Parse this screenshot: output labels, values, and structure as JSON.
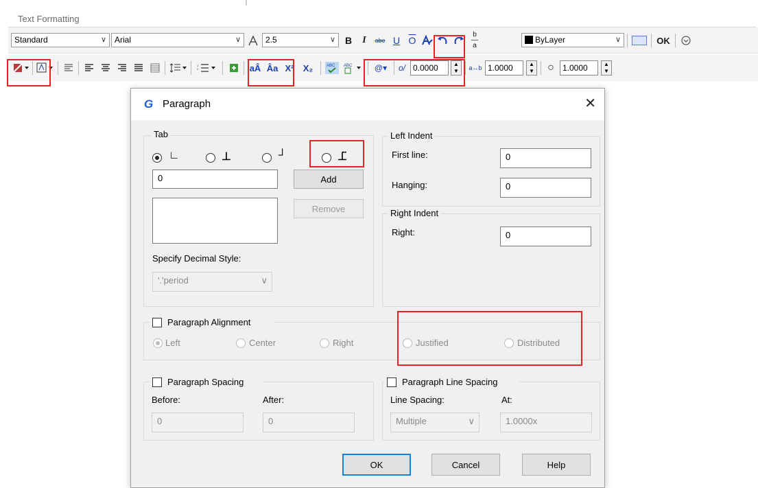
{
  "toolbar": {
    "title": "Text Formatting",
    "style_value": "Standard",
    "font_value": "Arial",
    "height_value": "2.5",
    "bold": "B",
    "italic": "I",
    "strike": "abe",
    "underline": "U",
    "overline": "O",
    "color_value": "ByLayer",
    "ok_label": "OK",
    "oblique_value": "0.0000",
    "tracking_value": "1.0000",
    "width_value": "1.0000",
    "superscript": "X²",
    "subscript": "X₂",
    "accent": "#e32424"
  },
  "dialog": {
    "title": "Paragraph",
    "tab_group": "Tab",
    "tab_value": "0",
    "add_button": "Add",
    "remove_button": "Remove",
    "decimal_label": "Specify Decimal Style:",
    "decimal_value": "'.'period",
    "left_indent": {
      "group": "Left Indent",
      "first_line_label": "First line:",
      "first_line_value": "0",
      "hanging_label": "Hanging:",
      "hanging_value": "0"
    },
    "right_indent": {
      "group": "Right Indent",
      "right_label": "Right:",
      "right_value": "0"
    },
    "alignment": {
      "label": "Paragraph Alignment",
      "options": [
        "Left",
        "Center",
        "Right",
        "Justified",
        "Distributed"
      ]
    },
    "spacing": {
      "label": "Paragraph Spacing",
      "before_label": "Before:",
      "before_value": "0",
      "after_label": "After:",
      "after_value": "0"
    },
    "line_spacing": {
      "label": "Paragraph Line Spacing",
      "spacing_label": "Line Spacing:",
      "spacing_value": "Multiple",
      "at_label": "At:",
      "at_value": "1.0000x"
    },
    "ok_button": "OK",
    "cancel_button": "Cancel",
    "help_button": "Help"
  }
}
